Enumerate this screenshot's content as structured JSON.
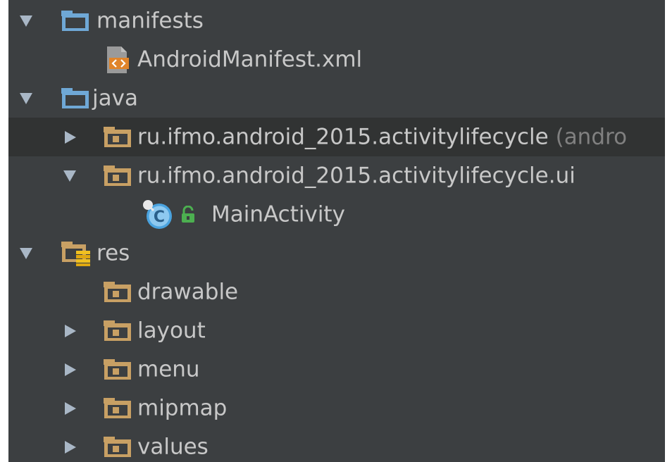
{
  "project_tree": {
    "manifests": {
      "label": "manifests",
      "children": {
        "android_manifest": {
          "label": "AndroidManifest.xml"
        }
      }
    },
    "java": {
      "label": "java",
      "packages": [
        {
          "label": "ru.ifmo.android_2015.activitylifecycle",
          "suffix": "(andro"
        },
        {
          "label": "ru.ifmo.android_2015.activitylifecycle.ui"
        }
      ],
      "classes": [
        {
          "label": "MainActivity"
        }
      ]
    },
    "res": {
      "label": "res",
      "children": [
        {
          "label": "drawable"
        },
        {
          "label": "layout"
        },
        {
          "label": "menu"
        },
        {
          "label": "mipmap"
        },
        {
          "label": "values"
        }
      ]
    }
  },
  "colors": {
    "panel_background": "#3c3f41",
    "selected_row": "#313333",
    "text": "#c8c8c8",
    "muted_text": "#808080",
    "blue_folder": "#6fa8d6",
    "tan_folder": "#c8a064",
    "xml_badge": "#e0842a",
    "class_icon": "#4aa3df",
    "lock_icon": "#4caf50"
  }
}
